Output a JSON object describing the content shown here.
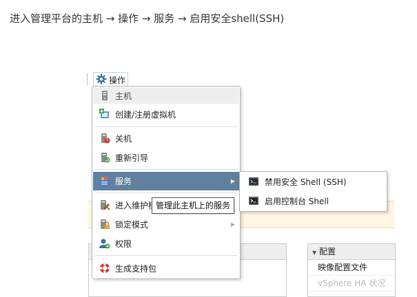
{
  "caption": "进入管理平台的主机 → 操作 → 服务 → 启用安全shell(SSH)",
  "actions_button": {
    "label": "操作",
    "icon": "gear-icon"
  },
  "menu": {
    "header": {
      "label": "主机",
      "icon": "host-icon"
    },
    "items": [
      {
        "label": "创建/注册虚拟机",
        "icon": "create-vm-icon"
      },
      {
        "label": "关机",
        "icon": "shutdown-icon"
      },
      {
        "label": "重新引导",
        "icon": "reboot-icon"
      },
      {
        "label": "服务",
        "icon": "services-icon",
        "highlighted": true
      },
      {
        "label": "进入维护模式",
        "icon": "maintenance-icon"
      },
      {
        "label": "锁定模式",
        "icon": "lockdown-icon"
      },
      {
        "label": "权限",
        "icon": "permissions-icon"
      },
      {
        "label": "生成支持包",
        "icon": "support-bundle-icon"
      }
    ]
  },
  "submenu": {
    "items": [
      {
        "label": "禁用安全 Shell (SSH)",
        "icon": "ssh-icon"
      },
      {
        "label": "启用控制台 Shell",
        "icon": "console-shell-icon"
      }
    ]
  },
  "tooltip": "管理此主机上的服务",
  "background": {
    "right_panel": {
      "title": "配置",
      "rows": [
        "映像配置文件",
        "vSphere HA 状况"
      ]
    }
  },
  "colors": {
    "highlight": "#61809f",
    "caption": "#333333"
  }
}
